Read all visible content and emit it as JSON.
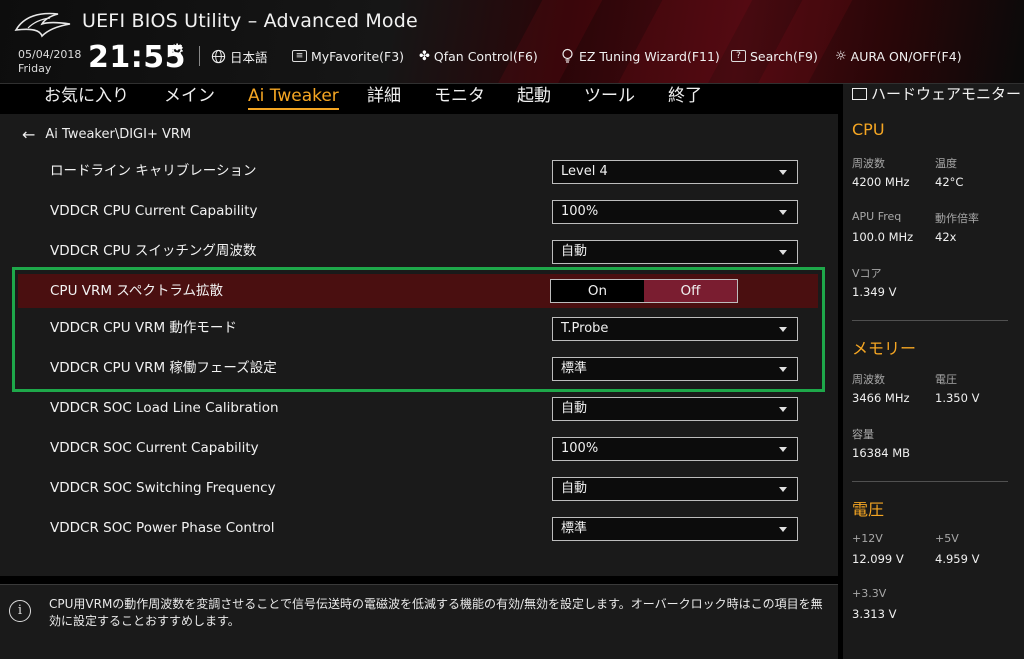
{
  "app": {
    "title": "UEFI BIOS Utility – Advanced Mode"
  },
  "clock": {
    "date": "05/04/2018",
    "day": "Friday",
    "time": "21:55"
  },
  "toolbar": {
    "language": "日本語",
    "myfavorite": "MyFavorite(F3)",
    "qfan": "Qfan Control(F6)",
    "ez_tuning": "EZ Tuning Wizard(F11)",
    "search": "Search(F9)",
    "aura": "AURA ON/OFF(F4)"
  },
  "nav": [
    "お気に入り",
    "メイン",
    "Ai Tweaker",
    "詳細",
    "モニタ",
    "起動",
    "ツール",
    "終了"
  ],
  "nav_active": "Ai Tweaker",
  "breadcrumb": "Ai Tweaker\\DIGI+ VRM",
  "settings": [
    {
      "label": "ロードライン キャリブレーション",
      "value": "Level 4"
    },
    {
      "label": "VDDCR CPU Current Capability",
      "value": "100%"
    },
    {
      "label": "VDDCR CPU スイッチング周波数",
      "value": "自動"
    },
    {
      "label": "CPU VRM スペクトラム拡散",
      "on": "On",
      "off": "Off",
      "selected": "Off"
    },
    {
      "label": "VDDCR CPU VRM 動作モード",
      "value": "T.Probe"
    },
    {
      "label": "VDDCR CPU VRM 稼働フェーズ設定",
      "value": "標準"
    },
    {
      "label": "VDDCR SOC Load Line Calibration",
      "value": "自動"
    },
    {
      "label": "VDDCR SOC Current Capability",
      "value": "100%"
    },
    {
      "label": "VDDCR SOC Switching Frequency",
      "value": "自動"
    },
    {
      "label": "VDDCR SOC Power Phase Control",
      "value": "標準"
    }
  ],
  "info": "CPU用VRMの動作周波数を変調させることで信号伝送時の電磁波を低減する機能の有効/無効を設定します。オーバークロック時はこの項目を無効に設定することおすすめします。",
  "hw": {
    "title": "ハードウェアモニター",
    "cpu": {
      "heading": "CPU",
      "freq_label": "周波数",
      "freq": "4200 MHz",
      "temp_label": "温度",
      "temp": "42°C",
      "apu_label": "APU Freq",
      "apu": "100.0 MHz",
      "ratio_label": "動作倍率",
      "ratio": "42x",
      "vcore_label": "Vコア",
      "vcore": "1.349 V"
    },
    "memory": {
      "heading": "メモリー",
      "freq_label": "周波数",
      "freq": "3466 MHz",
      "volt_label": "電圧",
      "volt": "1.350 V",
      "cap_label": "容量",
      "cap": "16384 MB"
    },
    "voltage": {
      "heading": "電圧",
      "v12_label": "+12V",
      "v12": "12.099 V",
      "v5_label": "+5V",
      "v5": "4.959 V",
      "v33_label": "+3.3V",
      "v33": "3.313 V"
    }
  },
  "colors": {
    "accent": "#f5a623",
    "highlight_row": "#4a0f10",
    "toggle_selected": "#7a1d30",
    "annotation_box": "#1ea84a"
  }
}
